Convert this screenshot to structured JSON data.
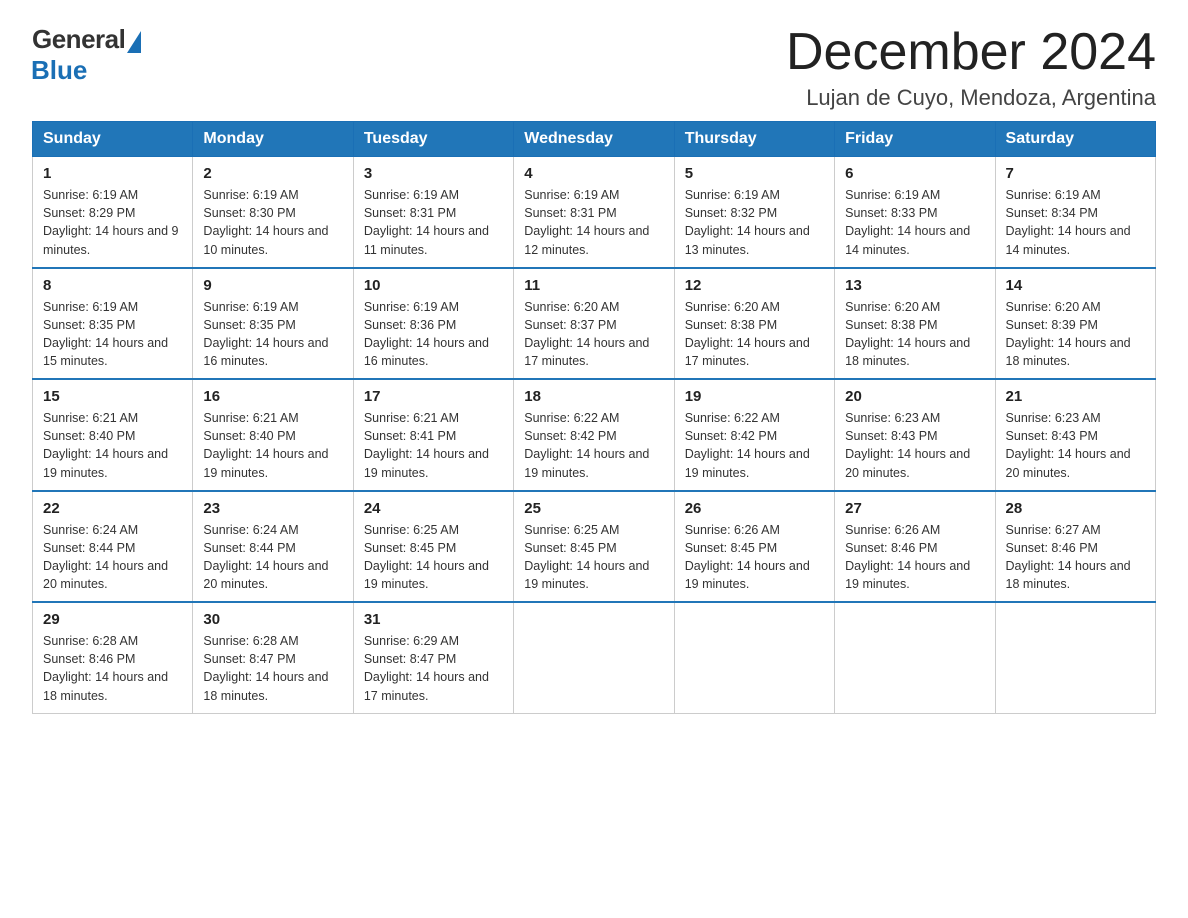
{
  "logo": {
    "general": "General",
    "blue": "Blue"
  },
  "title": "December 2024",
  "subtitle": "Lujan de Cuyo, Mendoza, Argentina",
  "days_header": [
    "Sunday",
    "Monday",
    "Tuesday",
    "Wednesday",
    "Thursday",
    "Friday",
    "Saturday"
  ],
  "weeks": [
    [
      {
        "day": "1",
        "sunrise": "6:19 AM",
        "sunset": "8:29 PM",
        "daylight": "14 hours and 9 minutes."
      },
      {
        "day": "2",
        "sunrise": "6:19 AM",
        "sunset": "8:30 PM",
        "daylight": "14 hours and 10 minutes."
      },
      {
        "day": "3",
        "sunrise": "6:19 AM",
        "sunset": "8:31 PM",
        "daylight": "14 hours and 11 minutes."
      },
      {
        "day": "4",
        "sunrise": "6:19 AM",
        "sunset": "8:31 PM",
        "daylight": "14 hours and 12 minutes."
      },
      {
        "day": "5",
        "sunrise": "6:19 AM",
        "sunset": "8:32 PM",
        "daylight": "14 hours and 13 minutes."
      },
      {
        "day": "6",
        "sunrise": "6:19 AM",
        "sunset": "8:33 PM",
        "daylight": "14 hours and 14 minutes."
      },
      {
        "day": "7",
        "sunrise": "6:19 AM",
        "sunset": "8:34 PM",
        "daylight": "14 hours and 14 minutes."
      }
    ],
    [
      {
        "day": "8",
        "sunrise": "6:19 AM",
        "sunset": "8:35 PM",
        "daylight": "14 hours and 15 minutes."
      },
      {
        "day": "9",
        "sunrise": "6:19 AM",
        "sunset": "8:35 PM",
        "daylight": "14 hours and 16 minutes."
      },
      {
        "day": "10",
        "sunrise": "6:19 AM",
        "sunset": "8:36 PM",
        "daylight": "14 hours and 16 minutes."
      },
      {
        "day": "11",
        "sunrise": "6:20 AM",
        "sunset": "8:37 PM",
        "daylight": "14 hours and 17 minutes."
      },
      {
        "day": "12",
        "sunrise": "6:20 AM",
        "sunset": "8:38 PM",
        "daylight": "14 hours and 17 minutes."
      },
      {
        "day": "13",
        "sunrise": "6:20 AM",
        "sunset": "8:38 PM",
        "daylight": "14 hours and 18 minutes."
      },
      {
        "day": "14",
        "sunrise": "6:20 AM",
        "sunset": "8:39 PM",
        "daylight": "14 hours and 18 minutes."
      }
    ],
    [
      {
        "day": "15",
        "sunrise": "6:21 AM",
        "sunset": "8:40 PM",
        "daylight": "14 hours and 19 minutes."
      },
      {
        "day": "16",
        "sunrise": "6:21 AM",
        "sunset": "8:40 PM",
        "daylight": "14 hours and 19 minutes."
      },
      {
        "day": "17",
        "sunrise": "6:21 AM",
        "sunset": "8:41 PM",
        "daylight": "14 hours and 19 minutes."
      },
      {
        "day": "18",
        "sunrise": "6:22 AM",
        "sunset": "8:42 PM",
        "daylight": "14 hours and 19 minutes."
      },
      {
        "day": "19",
        "sunrise": "6:22 AM",
        "sunset": "8:42 PM",
        "daylight": "14 hours and 19 minutes."
      },
      {
        "day": "20",
        "sunrise": "6:23 AM",
        "sunset": "8:43 PM",
        "daylight": "14 hours and 20 minutes."
      },
      {
        "day": "21",
        "sunrise": "6:23 AM",
        "sunset": "8:43 PM",
        "daylight": "14 hours and 20 minutes."
      }
    ],
    [
      {
        "day": "22",
        "sunrise": "6:24 AM",
        "sunset": "8:44 PM",
        "daylight": "14 hours and 20 minutes."
      },
      {
        "day": "23",
        "sunrise": "6:24 AM",
        "sunset": "8:44 PM",
        "daylight": "14 hours and 20 minutes."
      },
      {
        "day": "24",
        "sunrise": "6:25 AM",
        "sunset": "8:45 PM",
        "daylight": "14 hours and 19 minutes."
      },
      {
        "day": "25",
        "sunrise": "6:25 AM",
        "sunset": "8:45 PM",
        "daylight": "14 hours and 19 minutes."
      },
      {
        "day": "26",
        "sunrise": "6:26 AM",
        "sunset": "8:45 PM",
        "daylight": "14 hours and 19 minutes."
      },
      {
        "day": "27",
        "sunrise": "6:26 AM",
        "sunset": "8:46 PM",
        "daylight": "14 hours and 19 minutes."
      },
      {
        "day": "28",
        "sunrise": "6:27 AM",
        "sunset": "8:46 PM",
        "daylight": "14 hours and 18 minutes."
      }
    ],
    [
      {
        "day": "29",
        "sunrise": "6:28 AM",
        "sunset": "8:46 PM",
        "daylight": "14 hours and 18 minutes."
      },
      {
        "day": "30",
        "sunrise": "6:28 AM",
        "sunset": "8:47 PM",
        "daylight": "14 hours and 18 minutes."
      },
      {
        "day": "31",
        "sunrise": "6:29 AM",
        "sunset": "8:47 PM",
        "daylight": "14 hours and 17 minutes."
      },
      null,
      null,
      null,
      null
    ]
  ]
}
